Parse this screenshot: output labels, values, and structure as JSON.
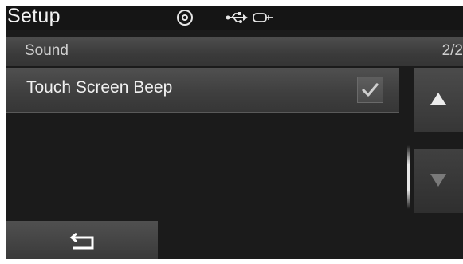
{
  "header": {
    "title": "Setup",
    "status_icons": [
      "disc-icon",
      "usb-icon",
      "aux-icon"
    ]
  },
  "section": {
    "title": "Sound",
    "page_indicator": "2/2"
  },
  "list": {
    "items": [
      {
        "label": "Touch Screen Beep",
        "checked": true
      }
    ]
  },
  "scroll": {
    "up_icon": "up-arrow-icon",
    "down_icon": "down-arrow-icon",
    "down_enabled": false
  },
  "footer": {
    "back_icon": "back-icon"
  },
  "colors": {
    "background": "#1b1b1b",
    "text": "#f0f0f0",
    "section_text": "#cfcfcf"
  }
}
